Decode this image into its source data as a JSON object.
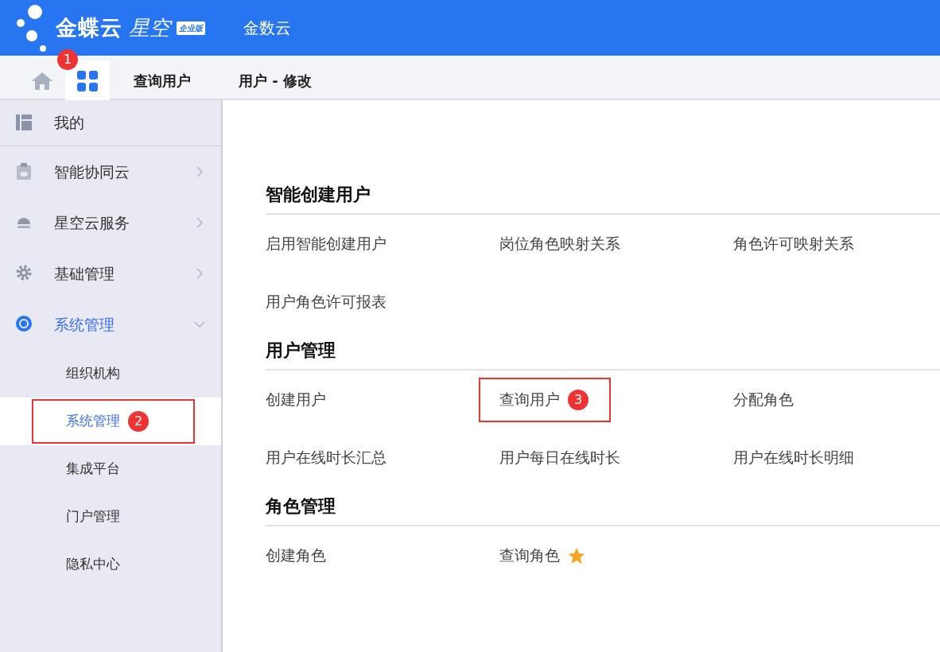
{
  "header": {
    "logo": {
      "brand": "金蝶云",
      "product": "星空",
      "edition": "企业版"
    },
    "app_name": "金数云"
  },
  "tabs": [
    {
      "kind": "home",
      "selected": false
    },
    {
      "kind": "apps",
      "selected": true,
      "callout": "1"
    },
    {
      "kind": "text",
      "label": "查询用户",
      "selected": false
    },
    {
      "kind": "text",
      "label": "用户 - 修改",
      "selected": false
    }
  ],
  "sidebar": {
    "items": [
      {
        "label": "我的",
        "selected": false
      },
      {
        "label": "智能协同云",
        "expanded": false,
        "selected": false
      },
      {
        "label": "星空云服务",
        "expanded": false,
        "selected": false
      },
      {
        "label": "基础管理",
        "expanded": false,
        "selected": false
      },
      {
        "label": "系统管理",
        "expanded": true,
        "selected": true,
        "children": [
          {
            "label": "组织机构",
            "selected": false
          },
          {
            "label": "系统管理",
            "selected": true,
            "callout": "2"
          },
          {
            "label": "集成平台",
            "selected": false
          },
          {
            "label": "门户管理",
            "selected": false
          },
          {
            "label": "隐私中心",
            "selected": false
          }
        ]
      }
    ]
  },
  "sections": [
    {
      "title": "智能创建用户",
      "links": [
        {
          "label": "启用智能创建用户"
        },
        {
          "label": "岗位角色映射关系"
        },
        {
          "label": "角色许可映射关系"
        },
        {
          "label": "用户角色许可报表"
        }
      ]
    },
    {
      "title": "用户管理",
      "links": [
        {
          "label": "创建用户"
        },
        {
          "label": "查询用户",
          "callout": "3"
        },
        {
          "label": "分配角色"
        },
        {
          "label": "用户在线时长汇总"
        },
        {
          "label": "用户每日在线时长"
        },
        {
          "label": "用户在线时长明细"
        }
      ]
    },
    {
      "title": "角色管理",
      "links": [
        {
          "label": "创建角色"
        },
        {
          "label": "查询角色",
          "starred": true
        }
      ]
    }
  ]
}
